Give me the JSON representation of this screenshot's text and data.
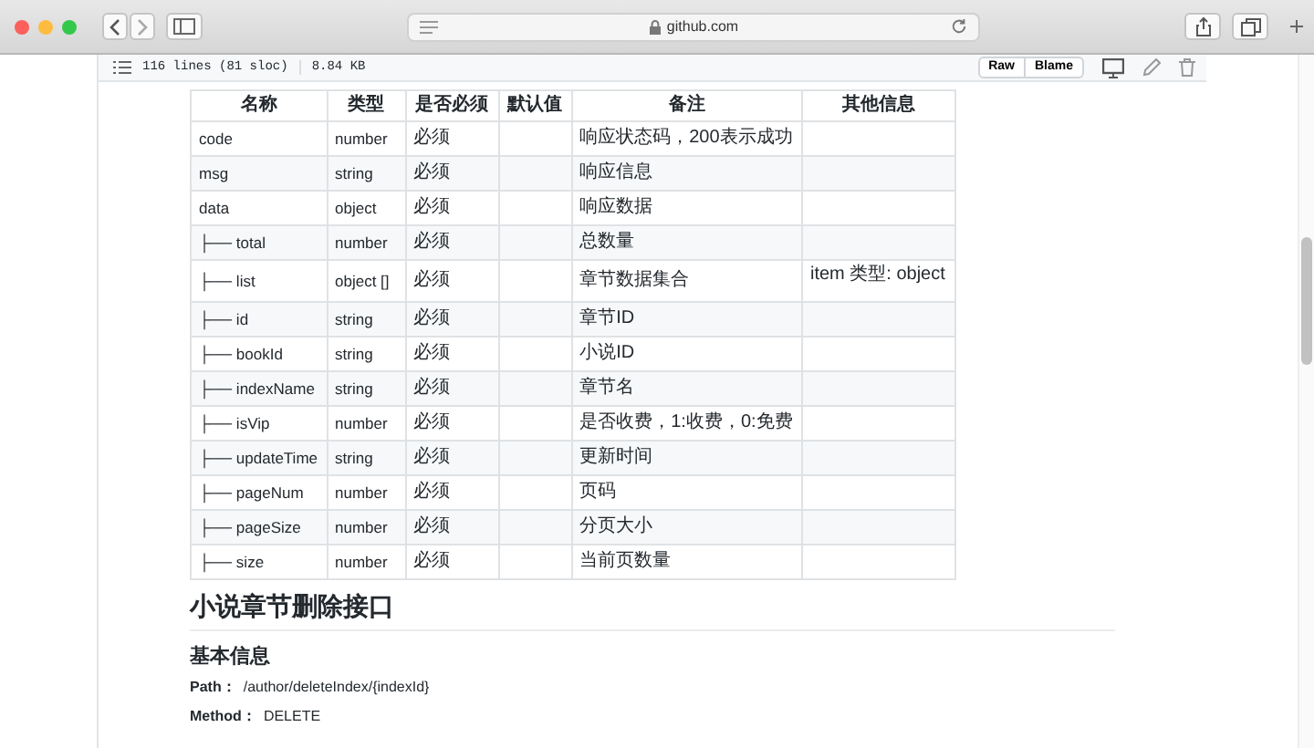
{
  "browser": {
    "url": "github.com"
  },
  "file_header": {
    "lines": "116 lines (81 sloc)",
    "size": "8.84 KB",
    "buttons": [
      "Raw",
      "Blame"
    ]
  },
  "table": {
    "columns": [
      "名称",
      "类型",
      "是否必须",
      "默认值",
      "备注",
      "其他信息"
    ],
    "rows": [
      {
        "name": "code",
        "type": "number",
        "required": "必须",
        "note": "响应状态码，200表示成功"
      },
      {
        "name": "msg",
        "type": "string",
        "required": "必须",
        "note": "响应信息"
      },
      {
        "name": "data",
        "type": "object",
        "required": "必须",
        "note": "响应数据"
      },
      {
        "name": "├── total",
        "type": "number",
        "required": "必须",
        "note": "总数量"
      },
      {
        "name": "├── list",
        "type": "object []",
        "required": "必须",
        "note": "章节数据集合",
        "other": "item 类型: object"
      },
      {
        "name": "├── id",
        "type": "string",
        "required": "必须",
        "note": "章节ID"
      },
      {
        "name": "├── bookId",
        "type": "string",
        "required": "必须",
        "note": "小说ID"
      },
      {
        "name": "├── indexName",
        "type": "string",
        "required": "必须",
        "note": "章节名"
      },
      {
        "name": "├── isVip",
        "type": "number",
        "required": "必须",
        "note": "是否收费，1:收费，0:免费"
      },
      {
        "name": "├── updateTime",
        "type": "string",
        "required": "必须",
        "note": "更新时间"
      },
      {
        "name": "├── pageNum",
        "type": "number",
        "required": "必须",
        "note": "页码"
      },
      {
        "name": "├── pageSize",
        "type": "number",
        "required": "必须",
        "note": "分页大小"
      },
      {
        "name": "├── size",
        "type": "number",
        "required": "必须",
        "note": "当前页数量"
      }
    ]
  },
  "section": {
    "heading": "小说章节删除接口",
    "subheading": "基本信息",
    "fields": [
      {
        "label": "Path：",
        "value": "/author/deleteIndex/{indexId}"
      },
      {
        "label": "Method：",
        "value": "DELETE"
      }
    ]
  }
}
